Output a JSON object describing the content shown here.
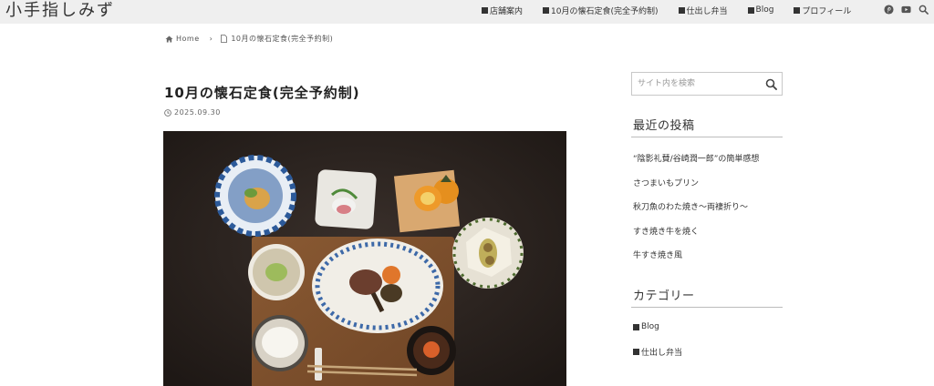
{
  "site": {
    "title": "小手指しみず"
  },
  "nav": {
    "items": [
      {
        "label": "店舗案内"
      },
      {
        "label": "10月の懐石定食(完全予約制)"
      },
      {
        "label": "仕出し弁当"
      },
      {
        "label": "Blog"
      },
      {
        "label": "プロフィール"
      }
    ],
    "social": [
      "pinterest-icon",
      "youtube-icon",
      "search-icon"
    ]
  },
  "breadcrumb": {
    "home": "Home",
    "current": "10月の懐石定食(完全予約制)"
  },
  "post": {
    "title": "10月の懐石定食(完全予約制)",
    "date": "2025.09.30"
  },
  "sidebar": {
    "search": {
      "placeholder": "サイト内を検索"
    },
    "recent": {
      "title": "最近の投稿",
      "items": [
        "“陰影礼賛/谷崎潤一郎”の簡単感想",
        "さつまいもプリン",
        "秋刀魚のわた焼き〜両褄折り〜",
        "すき焼き牛を焼く",
        "牛すき焼き風"
      ]
    },
    "categories": {
      "title": "カテゴリー",
      "items": [
        "Blog",
        "仕出し弁当"
      ]
    }
  },
  "colors": {
    "header_bg": "#efefef",
    "text": "#333333",
    "table": "#2a2320"
  }
}
